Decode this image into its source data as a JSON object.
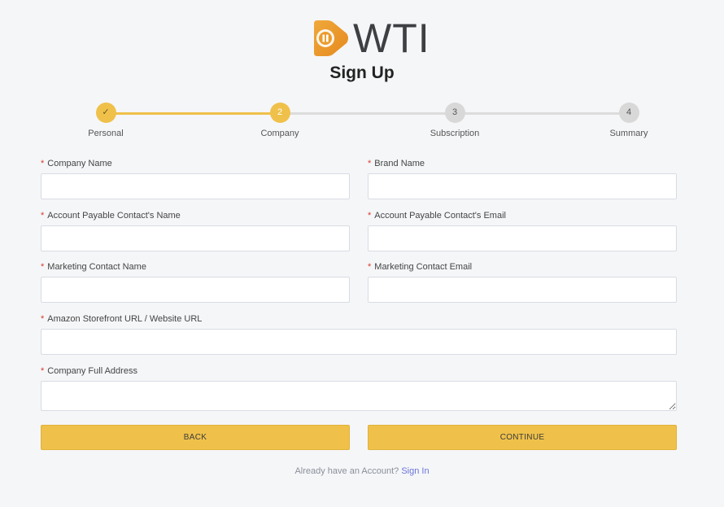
{
  "brand": {
    "logo_text": "WTI",
    "logo_icon": "play-pause-icon",
    "accent": "#efc14a"
  },
  "page": {
    "title": "Sign Up"
  },
  "stepper": {
    "steps": [
      {
        "label": "Personal",
        "marker": "✓",
        "state": "complete"
      },
      {
        "label": "Company",
        "marker": "2",
        "state": "active"
      },
      {
        "label": "Subscription",
        "marker": "3",
        "state": "pending"
      },
      {
        "label": "Summary",
        "marker": "4",
        "state": "pending"
      }
    ]
  },
  "form": {
    "required_mark": "*",
    "company_name": {
      "label": "Company Name",
      "value": ""
    },
    "brand_name": {
      "label": "Brand Name",
      "value": ""
    },
    "ap_contact_name": {
      "label": "Account Payable Contact's Name",
      "value": ""
    },
    "ap_contact_email": {
      "label": "Account Payable Contact's Email",
      "value": ""
    },
    "marketing_contact_name": {
      "label": "Marketing Contact Name",
      "value": ""
    },
    "marketing_contact_email": {
      "label": "Marketing Contact Email",
      "value": ""
    },
    "store_url": {
      "label": "Amazon Storefront URL / Website URL",
      "value": ""
    },
    "company_address": {
      "label": "Company Full Address",
      "value": ""
    }
  },
  "actions": {
    "back_label": "BACK",
    "continue_label": "CONTINUE"
  },
  "footer": {
    "prompt": "Already have an Account?",
    "sign_in_label": "Sign In"
  }
}
